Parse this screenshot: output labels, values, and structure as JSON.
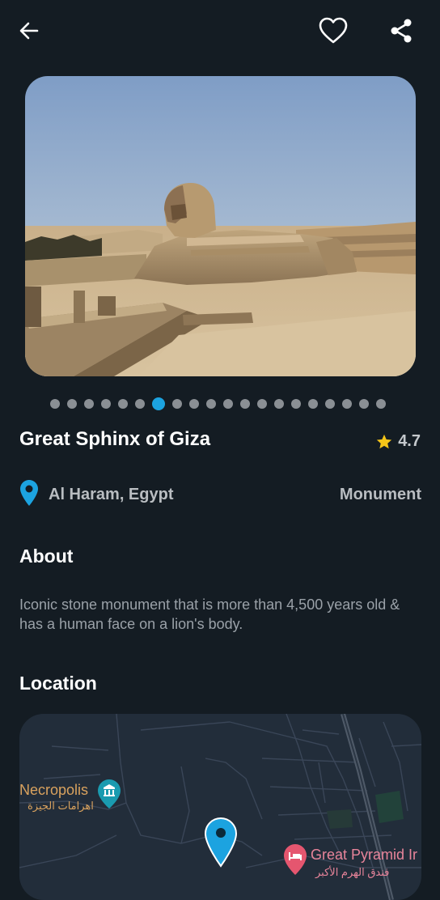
{
  "toolbar": {
    "back_icon": "arrow-left-icon",
    "favorite_icon": "heart-outline-icon",
    "share_icon": "share-icon"
  },
  "gallery": {
    "image_subject": "Great Sphinx of Giza photo",
    "count": 20,
    "active_index": 6
  },
  "place": {
    "name": "Great Sphinx of Giza",
    "rating": "4.7",
    "location": "Al Haram, Egypt",
    "category": "Monument"
  },
  "about": {
    "heading": "About",
    "text": "Iconic stone monument that is more than 4,500 years old & has a human face on a lion's body."
  },
  "location_section": {
    "heading": "Location",
    "map": {
      "necropolis_label": "Necropolis",
      "necropolis_sub": "اهرامات الجيزة",
      "hotel_label": "Great Pyramid Ir",
      "hotel_sub": "فندق الهرم الأكبر"
    }
  },
  "colors": {
    "background": "#141c23",
    "accent": "#1ca3e0",
    "star": "#f5c518",
    "map_orange": "#d9a25e",
    "map_pink": "#e5566f",
    "map_teal": "#1a9bb0"
  }
}
